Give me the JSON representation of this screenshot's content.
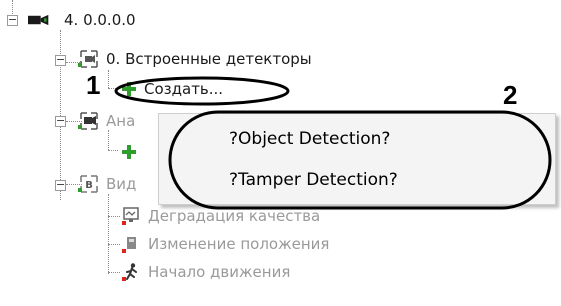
{
  "tree": {
    "server_label": "4. 0.0.0.0",
    "detectors_label": "0. Встроенные детекторы",
    "create_label": "Создать...",
    "analytics_label": "Ана",
    "video_label": "Вид",
    "quality_label": "Деградация качества",
    "position_label": "Изменение положения",
    "motion_label": "Начало движения"
  },
  "context_menu": {
    "items": [
      "?Object Detection?",
      "?Tamper Detection?"
    ]
  },
  "callouts": {
    "one": "1",
    "two": "2"
  },
  "colors": {
    "accent_green": "#2e9d2e",
    "accent_red": "#e0241c",
    "callout_black": "#000000"
  }
}
